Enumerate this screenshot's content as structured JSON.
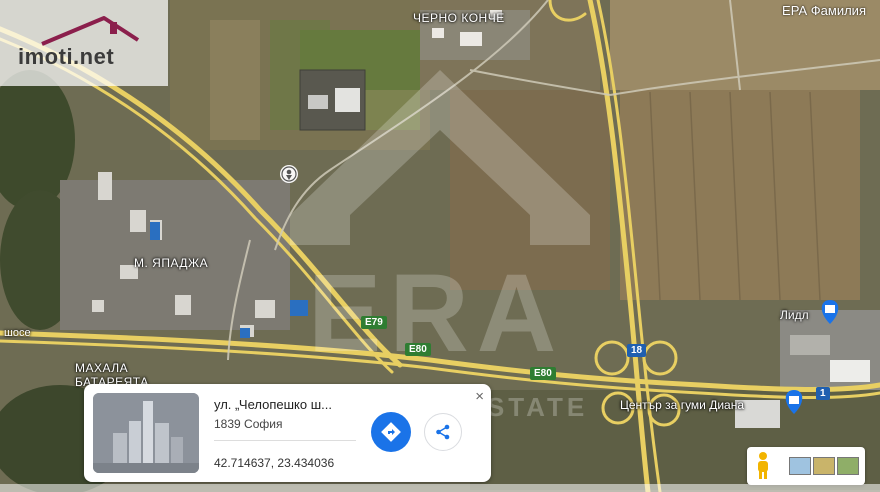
{
  "brand": {
    "site_logo": "imoti.net",
    "agency_name": "ЕРА Фамилия",
    "watermark_main": "ERA",
    "watermark_sub": "REAL ESTATE"
  },
  "map_labels": {
    "cherno_konche": "ЧЕРНО КОНЧЕ",
    "yapadzha": "М. ЯПАДЖА",
    "mahala_line1": "МАХАЛА",
    "mahala_line2": "БАТАРЕЯТА",
    "shose": "шосе",
    "lidl": "Лидл",
    "tire_center": "Център за гуми Диана"
  },
  "road_shields": {
    "e79": "E79",
    "e80_a": "E80",
    "e80_b": "E80",
    "r18": "18",
    "r1": "1"
  },
  "info_card": {
    "address": "ул. „Челопешко ш...",
    "postal_city": "1839 София",
    "coordinates": "42.714637, 23.434036",
    "close_symbol": "×"
  },
  "colors": {
    "directions_blue": "#1a73e8",
    "poi_marker_blue": "#1a73e8",
    "highway_yellow": "#e8cf62",
    "road_label_green": "#2f7d32"
  },
  "icons": {
    "directions": "directions-icon",
    "share": "share-icon",
    "pegman": "pegman-icon",
    "location_pin": "location-pin-icon"
  }
}
